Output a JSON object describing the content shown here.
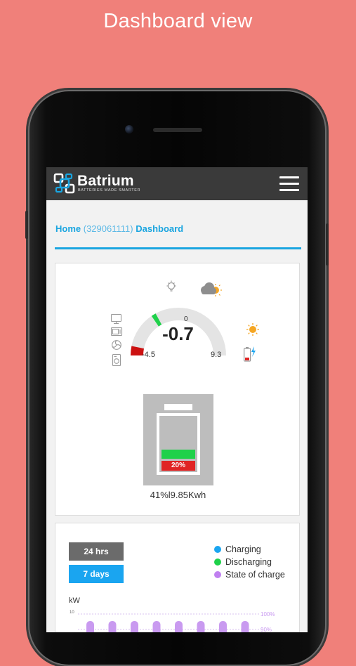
{
  "caption": "Dashboard view",
  "app": {
    "brand": "Batrium",
    "tagline": "BATTERIES MADE SMARTER"
  },
  "breadcrumb": {
    "home": "Home",
    "id": "(329061111)",
    "page": "Dashboard"
  },
  "gauge": {
    "zero_label": "0",
    "current_value": "-0.7",
    "min_label": "-4.5",
    "max_label": "9.3",
    "min": -4.5,
    "max": 9.3,
    "zero": 0,
    "current": -0.7,
    "icons": [
      "lightbulb-icon",
      "cloud-sun-icon",
      "sun-icon",
      "battery-charging-icon",
      "monitor-icon",
      "microwave-icon",
      "fan-icon",
      "washer-icon"
    ]
  },
  "battery": {
    "percent_label": "20%",
    "level": 20,
    "summary": "41%l9.85Kwh"
  },
  "history": {
    "button_24h": "24 hrs",
    "button_7d": "7 days",
    "legend": [
      {
        "label": "Charging",
        "color": "#1aa5f0"
      },
      {
        "label": "Discharging",
        "color": "#1fd14a"
      },
      {
        "label": "State of charge",
        "color": "#c080f0"
      }
    ],
    "unit": "kW",
    "y_tick": "10",
    "soc_100": "100%",
    "soc_90": "90%"
  },
  "colors": {
    "background": "#F0807A",
    "accent": "#1aa5e0",
    "appbar": "#3a3a3a",
    "charging": "#1aa5f0",
    "discharging": "#1fd14a",
    "soc": "#c080f0",
    "negative": "#cc1111"
  }
}
